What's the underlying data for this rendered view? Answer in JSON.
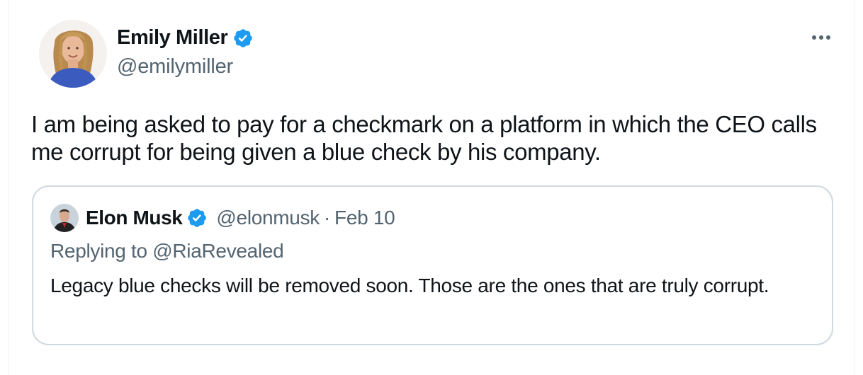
{
  "tweet": {
    "author": {
      "name": "Emily Miller",
      "handle": "@emilymiller",
      "verified": true
    },
    "more_label": "···",
    "text": "I am being asked to pay for a checkmark on a platform in which the CEO calls me corrupt for being given a blue check by his company."
  },
  "quote": {
    "author": {
      "name": "Elon Musk",
      "handle": "@elonmusk",
      "verified": true
    },
    "separator": "·",
    "date": "Feb 10",
    "replying_prefix": "Replying to ",
    "replying_to": "@RiaRevealed",
    "text": "Legacy blue checks will be removed soon. Those are the ones that are truly corrupt."
  },
  "colors": {
    "verified_blue": "#1d9bf0",
    "text_primary": "#0f1419",
    "text_secondary": "#536471",
    "border": "#cfd9de"
  },
  "icons": {
    "verified": "verified-badge-icon",
    "more": "more-horizontal-icon"
  }
}
